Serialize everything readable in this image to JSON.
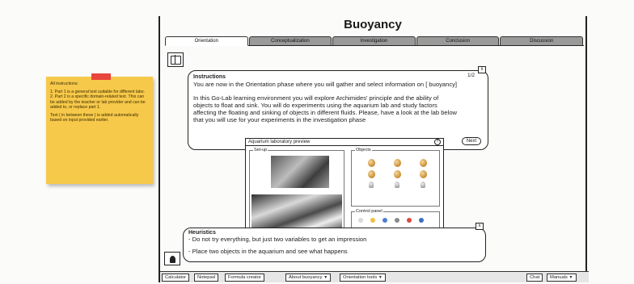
{
  "sticky_note": {
    "heading": "All instructions:",
    "line1": "1. Part 1 is a general text suitable for different labs.",
    "line2": "2. Part 2 is a specific domain-related text. This can be added by the teacher or lab provider and can be added to, or replace part 1.",
    "line3": "Text ( in between these ) is added automatically based on input provided earlier."
  },
  "app": {
    "title": "Buoyancy"
  },
  "tabs": [
    "Orientation",
    "Conceptualization",
    "Investigation",
    "Conclusion",
    "Discussion"
  ],
  "instructions": {
    "heading": "Instructions",
    "pager": "1/2",
    "paragraph1": "You are now in the Orientation phase where you will gather and select information on [ buoyancy]",
    "paragraph2": "In this Go-Lab learning environment you will explore Archimides' principle and the ability of objects to float and sink. You will do experiments using the aquarium lab and study factors affecting the floating and sinking of objects in different fluids. Please, have a look at the lab below that you will use for your experiments in the investigation phase",
    "next_label": "Next",
    "close_label": "x"
  },
  "lab_preview": {
    "title": "Aquarium laboratory preview",
    "help": "?",
    "setup_label": "Set-up",
    "objects_label": "Objects",
    "control_label": "Control panel"
  },
  "heuristics": {
    "heading": "Heuristics",
    "line1": "- Do not try everything, but just two variables to get an impression",
    "line2": "- Place two objects in the aquarium and see what happens",
    "close_label": "x"
  },
  "bottom_bar": {
    "calculator": "Calculator",
    "notepad": "Notepad",
    "formula_creator": "Formula creator",
    "about": "About buoyancy",
    "orientation_tools": "Orientation tools",
    "chat": "Chat",
    "manuals": "Manuals"
  },
  "colors": {
    "sticky": "#f7c94a",
    "tape": "#e8453c",
    "tab_inactive": "#9a9a9a"
  }
}
